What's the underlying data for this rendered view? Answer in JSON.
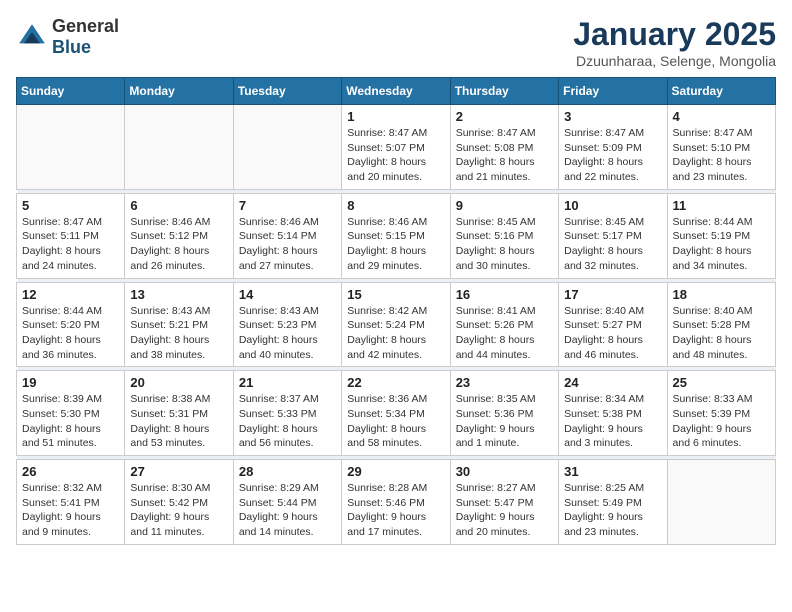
{
  "logo": {
    "general": "General",
    "blue": "Blue"
  },
  "title": "January 2025",
  "subtitle": "Dzuunharaa, Selenge, Mongolia",
  "weekdays": [
    "Sunday",
    "Monday",
    "Tuesday",
    "Wednesday",
    "Thursday",
    "Friday",
    "Saturday"
  ],
  "weeks": [
    [
      {
        "day": "",
        "sunrise": "",
        "sunset": "",
        "daylight": ""
      },
      {
        "day": "",
        "sunrise": "",
        "sunset": "",
        "daylight": ""
      },
      {
        "day": "",
        "sunrise": "",
        "sunset": "",
        "daylight": ""
      },
      {
        "day": "1",
        "sunrise": "Sunrise: 8:47 AM",
        "sunset": "Sunset: 5:07 PM",
        "daylight": "Daylight: 8 hours and 20 minutes."
      },
      {
        "day": "2",
        "sunrise": "Sunrise: 8:47 AM",
        "sunset": "Sunset: 5:08 PM",
        "daylight": "Daylight: 8 hours and 21 minutes."
      },
      {
        "day": "3",
        "sunrise": "Sunrise: 8:47 AM",
        "sunset": "Sunset: 5:09 PM",
        "daylight": "Daylight: 8 hours and 22 minutes."
      },
      {
        "day": "4",
        "sunrise": "Sunrise: 8:47 AM",
        "sunset": "Sunset: 5:10 PM",
        "daylight": "Daylight: 8 hours and 23 minutes."
      }
    ],
    [
      {
        "day": "5",
        "sunrise": "Sunrise: 8:47 AM",
        "sunset": "Sunset: 5:11 PM",
        "daylight": "Daylight: 8 hours and 24 minutes."
      },
      {
        "day": "6",
        "sunrise": "Sunrise: 8:46 AM",
        "sunset": "Sunset: 5:12 PM",
        "daylight": "Daylight: 8 hours and 26 minutes."
      },
      {
        "day": "7",
        "sunrise": "Sunrise: 8:46 AM",
        "sunset": "Sunset: 5:14 PM",
        "daylight": "Daylight: 8 hours and 27 minutes."
      },
      {
        "day": "8",
        "sunrise": "Sunrise: 8:46 AM",
        "sunset": "Sunset: 5:15 PM",
        "daylight": "Daylight: 8 hours and 29 minutes."
      },
      {
        "day": "9",
        "sunrise": "Sunrise: 8:45 AM",
        "sunset": "Sunset: 5:16 PM",
        "daylight": "Daylight: 8 hours and 30 minutes."
      },
      {
        "day": "10",
        "sunrise": "Sunrise: 8:45 AM",
        "sunset": "Sunset: 5:17 PM",
        "daylight": "Daylight: 8 hours and 32 minutes."
      },
      {
        "day": "11",
        "sunrise": "Sunrise: 8:44 AM",
        "sunset": "Sunset: 5:19 PM",
        "daylight": "Daylight: 8 hours and 34 minutes."
      }
    ],
    [
      {
        "day": "12",
        "sunrise": "Sunrise: 8:44 AM",
        "sunset": "Sunset: 5:20 PM",
        "daylight": "Daylight: 8 hours and 36 minutes."
      },
      {
        "day": "13",
        "sunrise": "Sunrise: 8:43 AM",
        "sunset": "Sunset: 5:21 PM",
        "daylight": "Daylight: 8 hours and 38 minutes."
      },
      {
        "day": "14",
        "sunrise": "Sunrise: 8:43 AM",
        "sunset": "Sunset: 5:23 PM",
        "daylight": "Daylight: 8 hours and 40 minutes."
      },
      {
        "day": "15",
        "sunrise": "Sunrise: 8:42 AM",
        "sunset": "Sunset: 5:24 PM",
        "daylight": "Daylight: 8 hours and 42 minutes."
      },
      {
        "day": "16",
        "sunrise": "Sunrise: 8:41 AM",
        "sunset": "Sunset: 5:26 PM",
        "daylight": "Daylight: 8 hours and 44 minutes."
      },
      {
        "day": "17",
        "sunrise": "Sunrise: 8:40 AM",
        "sunset": "Sunset: 5:27 PM",
        "daylight": "Daylight: 8 hours and 46 minutes."
      },
      {
        "day": "18",
        "sunrise": "Sunrise: 8:40 AM",
        "sunset": "Sunset: 5:28 PM",
        "daylight": "Daylight: 8 hours and 48 minutes."
      }
    ],
    [
      {
        "day": "19",
        "sunrise": "Sunrise: 8:39 AM",
        "sunset": "Sunset: 5:30 PM",
        "daylight": "Daylight: 8 hours and 51 minutes."
      },
      {
        "day": "20",
        "sunrise": "Sunrise: 8:38 AM",
        "sunset": "Sunset: 5:31 PM",
        "daylight": "Daylight: 8 hours and 53 minutes."
      },
      {
        "day": "21",
        "sunrise": "Sunrise: 8:37 AM",
        "sunset": "Sunset: 5:33 PM",
        "daylight": "Daylight: 8 hours and 56 minutes."
      },
      {
        "day": "22",
        "sunrise": "Sunrise: 8:36 AM",
        "sunset": "Sunset: 5:34 PM",
        "daylight": "Daylight: 8 hours and 58 minutes."
      },
      {
        "day": "23",
        "sunrise": "Sunrise: 8:35 AM",
        "sunset": "Sunset: 5:36 PM",
        "daylight": "Daylight: 9 hours and 1 minute."
      },
      {
        "day": "24",
        "sunrise": "Sunrise: 8:34 AM",
        "sunset": "Sunset: 5:38 PM",
        "daylight": "Daylight: 9 hours and 3 minutes."
      },
      {
        "day": "25",
        "sunrise": "Sunrise: 8:33 AM",
        "sunset": "Sunset: 5:39 PM",
        "daylight": "Daylight: 9 hours and 6 minutes."
      }
    ],
    [
      {
        "day": "26",
        "sunrise": "Sunrise: 8:32 AM",
        "sunset": "Sunset: 5:41 PM",
        "daylight": "Daylight: 9 hours and 9 minutes."
      },
      {
        "day": "27",
        "sunrise": "Sunrise: 8:30 AM",
        "sunset": "Sunset: 5:42 PM",
        "daylight": "Daylight: 9 hours and 11 minutes."
      },
      {
        "day": "28",
        "sunrise": "Sunrise: 8:29 AM",
        "sunset": "Sunset: 5:44 PM",
        "daylight": "Daylight: 9 hours and 14 minutes."
      },
      {
        "day": "29",
        "sunrise": "Sunrise: 8:28 AM",
        "sunset": "Sunset: 5:46 PM",
        "daylight": "Daylight: 9 hours and 17 minutes."
      },
      {
        "day": "30",
        "sunrise": "Sunrise: 8:27 AM",
        "sunset": "Sunset: 5:47 PM",
        "daylight": "Daylight: 9 hours and 20 minutes."
      },
      {
        "day": "31",
        "sunrise": "Sunrise: 8:25 AM",
        "sunset": "Sunset: 5:49 PM",
        "daylight": "Daylight: 9 hours and 23 minutes."
      },
      {
        "day": "",
        "sunrise": "",
        "sunset": "",
        "daylight": ""
      }
    ]
  ]
}
